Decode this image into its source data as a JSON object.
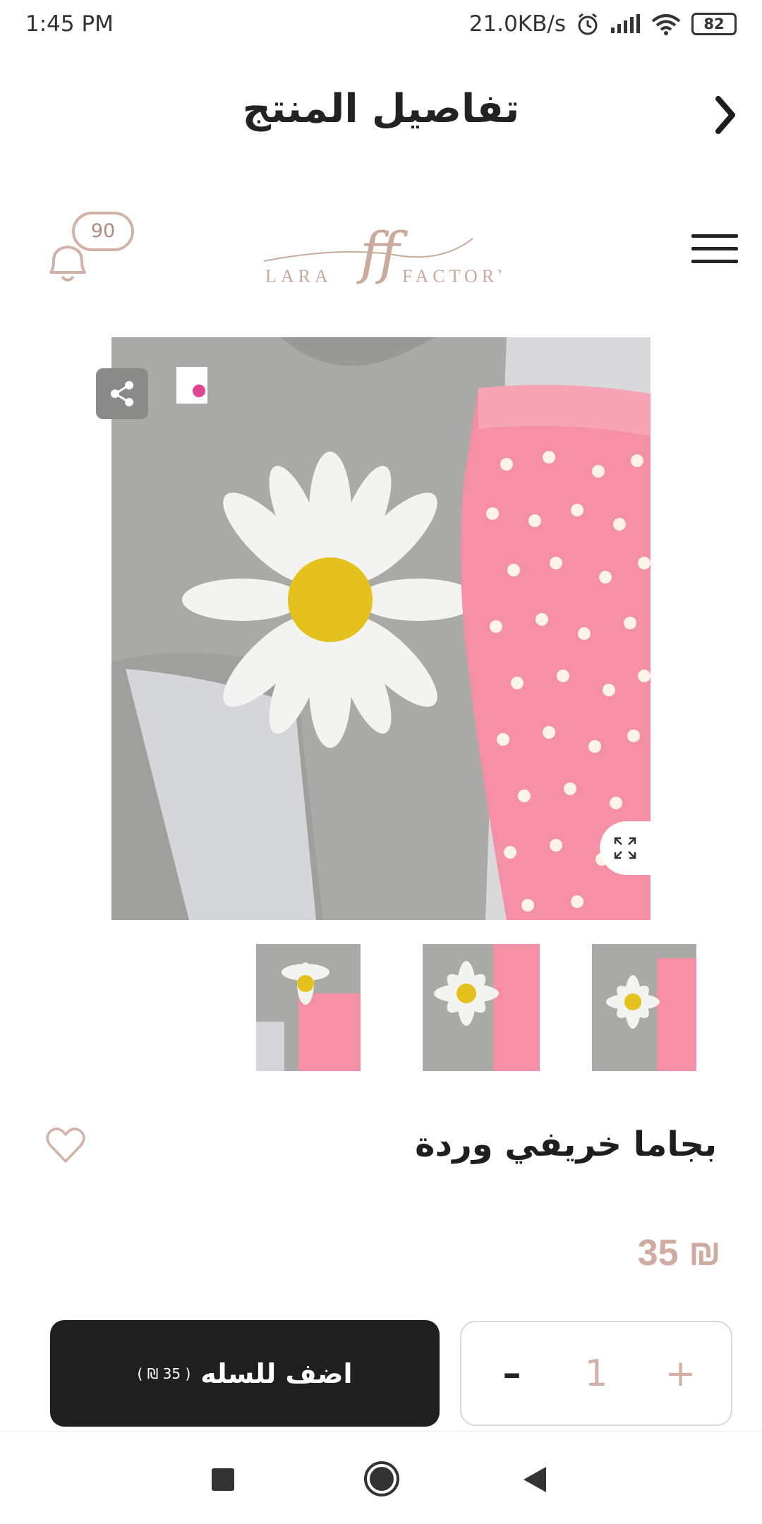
{
  "status_bar": {
    "time": "1:45 PM",
    "network_speed": "21.0KB/s",
    "battery": "82"
  },
  "header": {
    "title": "تفاصيل المنتج",
    "back_icon": "chevron-right-icon"
  },
  "brand": {
    "logo_text_left": "LARA",
    "logo_monogram": "ff",
    "logo_text_right": "FACTORY",
    "notification_count": "90",
    "menu_icon": "hamburger-icon"
  },
  "product": {
    "name": "بجاما خريفي وردة",
    "price": "35 ₪",
    "thumbnail_count": 3
  },
  "cart": {
    "add_label": "اضف للسله",
    "add_price": "( 35 ₪ )",
    "quantity": "1",
    "minus_label": "–",
    "plus_label": "+"
  },
  "colors": {
    "accent": "#d0aba0",
    "button_dark": "#1f1f1f",
    "pants_pink": "#f58fa6",
    "shirt_gray": "#a9aaa6",
    "daisy_center": "#e4c11d"
  }
}
